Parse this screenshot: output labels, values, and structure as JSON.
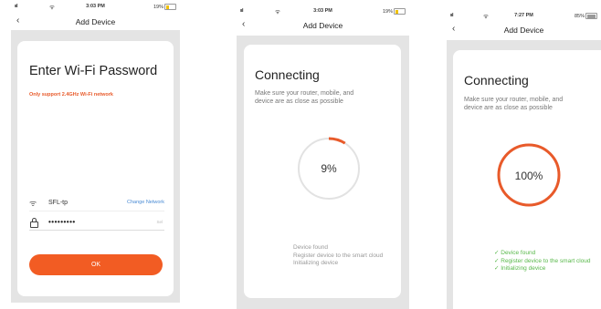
{
  "screens": [
    {
      "status": {
        "signal": "ııl",
        "time": "3:03 PM",
        "battery": "19%"
      },
      "nav": {
        "title": "Add Device"
      },
      "title": "Enter Wi-Fi Password",
      "note": "Only support 2.4GHz Wi-Fi network",
      "wifi": {
        "ssid": "SFL-tp",
        "change_label": "Change Network"
      },
      "password": {
        "value": "•••••••••",
        "eye_label": "Sel"
      },
      "ok_label": "OK"
    },
    {
      "status": {
        "signal": "ııl",
        "time": "3:03 PM",
        "battery": "19%"
      },
      "nav": {
        "title": "Add Device"
      },
      "title": "Connecting",
      "subtitle": [
        "Make sure your router, mobile, and",
        "device are as close as possible"
      ],
      "progress": {
        "label": "9%",
        "value": 0.09
      },
      "steps": [
        "Device found",
        "Register device to the smart cloud",
        "Initializing device"
      ]
    },
    {
      "status": {
        "signal": "ııl",
        "time": "7:27 PM",
        "battery": "85%"
      },
      "nav": {
        "title": "Add Device"
      },
      "title": "Connecting",
      "subtitle": [
        "Make sure your router, mobile, and",
        "device are as close as possible"
      ],
      "progress": {
        "label": "100%",
        "value": 1.0
      },
      "steps": [
        "✓ Device found",
        "✓ Register device to the smart cloud",
        "✓ Initializing device"
      ]
    }
  ],
  "colors": {
    "accent": "#f25c23",
    "ring_track": "#e2e2e2",
    "ring_fill": "#e85a2a",
    "success": "#58b84a",
    "link": "#4a8bd4"
  }
}
